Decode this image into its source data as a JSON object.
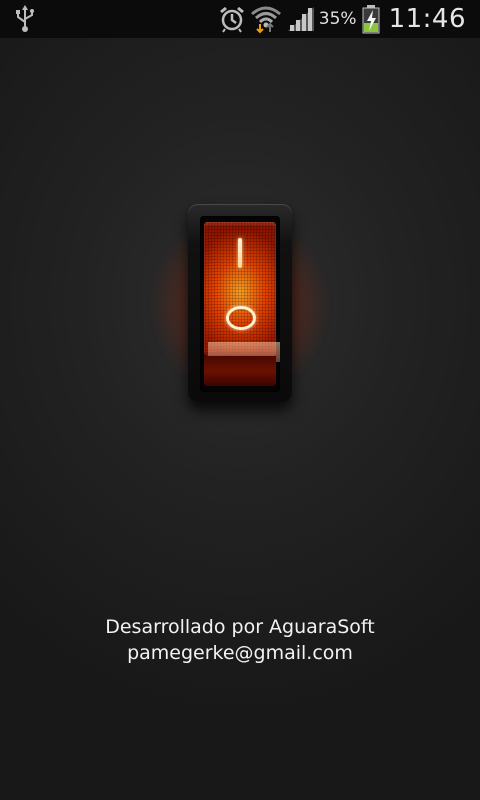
{
  "status_bar": {
    "battery_percent": "35%",
    "time": "11:46",
    "icons": [
      "usb-icon",
      "alarm-icon",
      "wifi-icon",
      "signal-icon",
      "battery-charging-icon"
    ]
  },
  "switch": {
    "state": "on",
    "on_mark": "I",
    "off_mark": "O",
    "glow_color": "#ff4a00"
  },
  "credits": {
    "line1": "Desarrollado por AguaraSoft",
    "line2": "pamegerke@gmail.com"
  }
}
